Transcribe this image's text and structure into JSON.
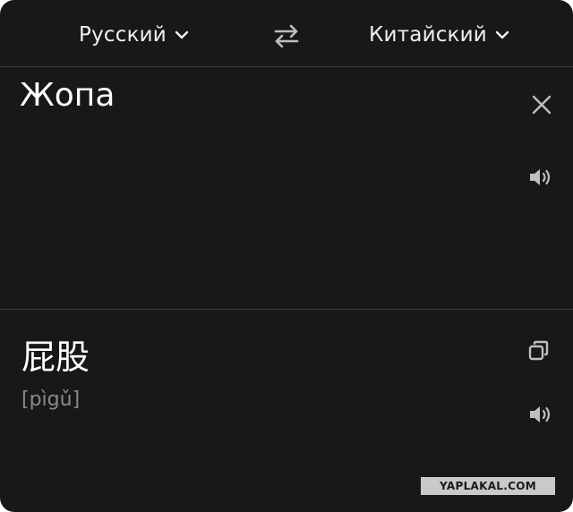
{
  "header": {
    "source_language": "Русский",
    "target_language": "Китайский",
    "icons": {
      "dropdown": "chevron-down-icon",
      "swap": "swap-arrows-icon"
    }
  },
  "input": {
    "text": "Жопа",
    "icons": {
      "clear": "close-icon",
      "speak": "speaker-icon"
    }
  },
  "output": {
    "text": "屁股",
    "transliteration": "[pìgǔ]",
    "icons": {
      "copy": "copy-icon",
      "speak": "speaker-icon"
    }
  },
  "watermark": {
    "text": "YAPLAKAL.COM"
  },
  "colors": {
    "background": "#181818",
    "text": "#f2f2f2",
    "muted": "#8a8a8a",
    "icon": "#bfbfbf",
    "divider": "#3a3a3a"
  }
}
